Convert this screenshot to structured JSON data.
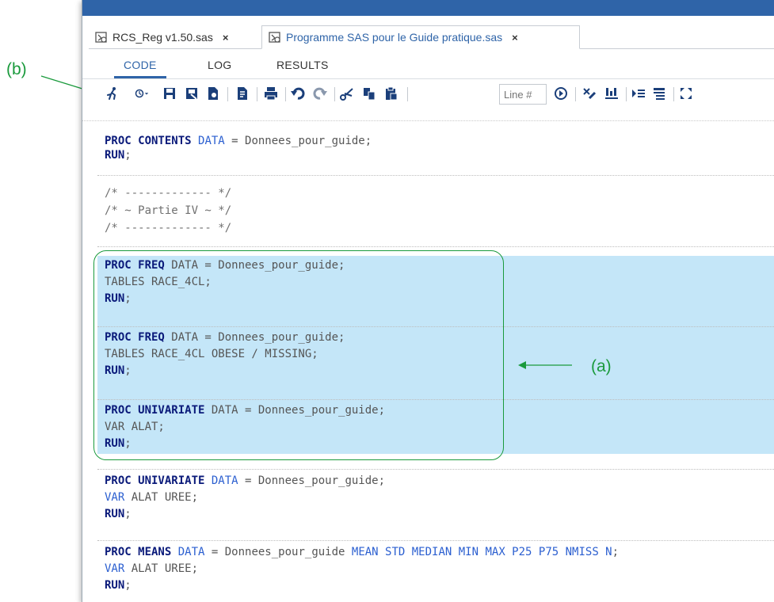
{
  "annotations": {
    "b_label": "(b)",
    "a_label": "(a)"
  },
  "tabs": [
    {
      "label": "RCS_Reg v1.50.sas",
      "close": "×"
    },
    {
      "label": "Programme SAS pour le Guide pratique.sas",
      "close": "×"
    }
  ],
  "subtabs": [
    "CODE",
    "LOG",
    "RESULTS"
  ],
  "toolbar": {
    "line_placeholder": "Line #",
    "icons": [
      "run-icon",
      "history-icon",
      "save-icon",
      "save-as-icon",
      "save-copy-icon",
      "format-icon",
      "print-icon",
      "undo-icon",
      "redo-icon",
      "cut-icon",
      "copy-icon",
      "paste-icon",
      "submit-icon",
      "clear-icon",
      "snippet-icon",
      "indent-icon",
      "outline-icon",
      "maximize-icon"
    ]
  },
  "code": {
    "b1_l1_kw": "PROC CONTENTS",
    "b1_l1_opt": "DATA",
    "b1_l1_txt": " = Donnees_pour_guide;",
    "b1_l2_kw": "RUN",
    "b1_l2_txt": ";",
    "c1": "/* ------------- */",
    "c2": "/* ~ Partie IV ~ */",
    "c3": "/* ------------- */",
    "b2_l1_kw": "PROC FREQ",
    "b2_l1_txt": " DATA = Donnees_pour_guide;",
    "b2_l2_txt": "TABLES RACE_4CL;",
    "b2_l3_kw": "RUN",
    "b2_l3_txt": ";",
    "b3_l1_kw": "PROC FREQ",
    "b3_l1_txt": " DATA = Donnees_pour_guide;",
    "b3_l2_txt": "TABLES RACE_4CL OBESE / MISSING;",
    "b3_l3_kw": "RUN",
    "b3_l3_txt": ";",
    "b4_l1_kw": "PROC UNIVARIATE",
    "b4_l1_txt": " DATA = Donnees_pour_guide;",
    "b4_l2_txt": "VAR ALAT;",
    "b4_l3_kw": "RUN",
    "b4_l3_txt": ";",
    "b5_l1_kw": "PROC UNIVARIATE",
    "b5_l1_opt": "DATA",
    "b5_l1_txt": " = Donnees_pour_guide;",
    "b5_l2_opt": "VAR",
    "b5_l2_txt": " ALAT UREE;",
    "b5_l3_kw": "RUN",
    "b5_l3_txt": ";",
    "b6_l1_kw": "PROC MEANS",
    "b6_l1_opt": "DATA",
    "b6_l1_txt": " = Donnees_pour_guide ",
    "b6_l1_opt2": "MEAN STD MEDIAN MIN MAX P25 P75 NMISS N",
    "b6_l1_txt2": ";",
    "b6_l2_opt": "VAR",
    "b6_l2_txt": " ALAT UREE;",
    "b6_l3_kw": "RUN",
    "b6_l3_txt": ";"
  },
  "colors": {
    "accent": "#2f64a8",
    "annotation": "#1a9a3c",
    "selection": "#c4e6f8"
  }
}
